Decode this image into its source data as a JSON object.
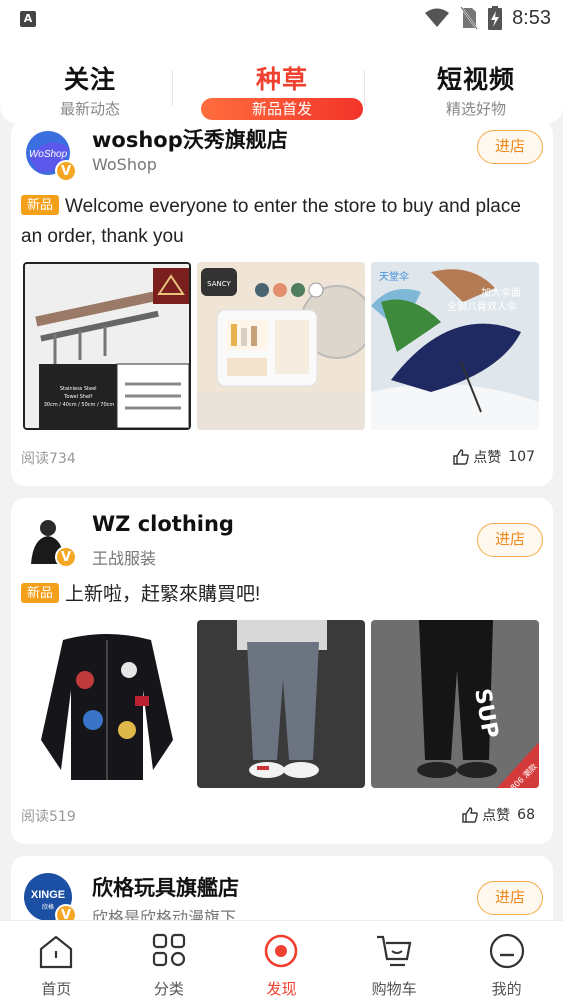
{
  "status": {
    "left_icon_letter": "A",
    "time": "8:53"
  },
  "topnav": {
    "tabs": [
      {
        "title": "关注",
        "sub": "最新动态"
      },
      {
        "title": "种草",
        "sub": "新品首发"
      },
      {
        "title": "短视频",
        "sub": "精选好物"
      }
    ],
    "active_index": 1
  },
  "feed": [
    {
      "shop_name": "woshop沃秀旗舰店",
      "shop_sub": "WoShop",
      "avatar_text": "WoShop",
      "enter_label": "进店",
      "tag": "新品",
      "text": "Welcome everyone to enter the store to buy and place an order, thank you",
      "thumbs": [
        "towel-rack",
        "bathroom-cabinet",
        "umbrella"
      ],
      "thumb_texts": {
        "rack_caption": "Stainless Steel Towel Shelf 30cm / 40cm / 50cm / 70cm",
        "cabinet_brand": "SANCY",
        "umbrella_brand": "天堂伞",
        "umbrella_slogan1": "加大伞面",
        "umbrella_slogan2": "全钢八骨双人伞"
      },
      "reads": "阅读734",
      "likes_label": "点赞",
      "likes": "107"
    },
    {
      "shop_name": "WZ clothing",
      "shop_sub": "王战服装",
      "enter_label": "进店",
      "tag": "新品",
      "text": "上新啦，赶緊來購買吧!",
      "thumbs": [
        "bomber-jacket",
        "jeans",
        "joggers"
      ],
      "thumb_texts": {
        "joggers_print": "SUP",
        "joggers_corner": "1806 潮款"
      },
      "reads": "阅读519",
      "likes_label": "点赞",
      "likes": "68"
    },
    {
      "shop_name": "欣格玩具旗艦店",
      "shop_sub": "欣格是欣格动漫旗下…",
      "avatar_text": "XINGE",
      "avatar_subtext": "欣格",
      "enter_label": "进店"
    }
  ],
  "bottomnav": {
    "items": [
      {
        "label": "首页",
        "icon": "home-icon"
      },
      {
        "label": "分类",
        "icon": "category-icon"
      },
      {
        "label": "发现",
        "icon": "discover-icon"
      },
      {
        "label": "购物车",
        "icon": "cart-icon"
      },
      {
        "label": "我的",
        "icon": "profile-icon"
      }
    ],
    "active_index": 2
  },
  "colors": {
    "accent": "#f0402f",
    "tag": "#f5a01a",
    "enter_border": "#f5a94a"
  }
}
